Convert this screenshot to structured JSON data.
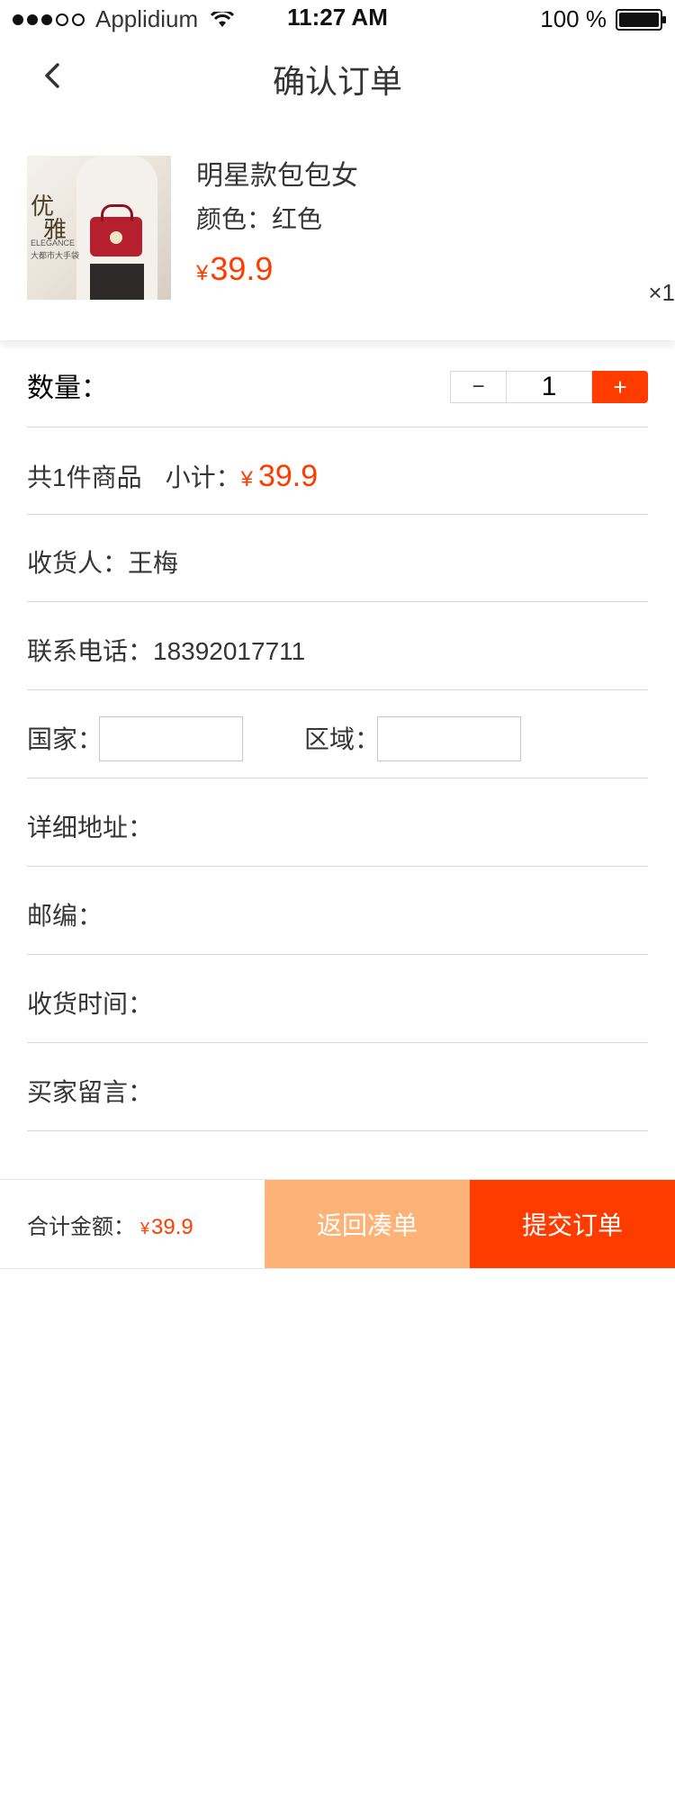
{
  "status_bar": {
    "carrier": "Applidium",
    "time": "11:27 AM",
    "battery": "100 %"
  },
  "nav": {
    "title": "确认订单"
  },
  "product": {
    "image_text": {
      "line1": "优",
      "line2": "雅",
      "line3": "ELEGANCE",
      "line4": "大都市大手袋"
    },
    "name": "明星款包包女",
    "color": "颜色：红色",
    "price_symbol": "¥",
    "price": "39.9",
    "quantity": "×1"
  },
  "quantity_row": {
    "label": "数量：",
    "value": "1",
    "minus": "−",
    "plus": "+"
  },
  "subtotal_row": {
    "count_text": "共1件商品",
    "subtotal_label": "小计：",
    "price_symbol": "¥",
    "price": "39.9"
  },
  "recipient": {
    "label": "收货人：王梅"
  },
  "phone": {
    "label": "联系电话：18392017711"
  },
  "region_row": {
    "country_label": "国家：",
    "country_value": "",
    "area_label": "区域：",
    "area_value": ""
  },
  "address": {
    "label": "详细地址："
  },
  "postcode": {
    "label": "邮编："
  },
  "delivery_time": {
    "label": "收货时间："
  },
  "buyer_message": {
    "label": "买家留言："
  },
  "bottom_bar": {
    "total_label": "合计金额：",
    "price_symbol": "¥",
    "total_price": "39.9",
    "back_button": "返回凑单",
    "submit_button": "提交订单"
  },
  "colors": {
    "accent": "#ff3c00",
    "secondary_button": "#ffb277",
    "text": "#353535"
  }
}
